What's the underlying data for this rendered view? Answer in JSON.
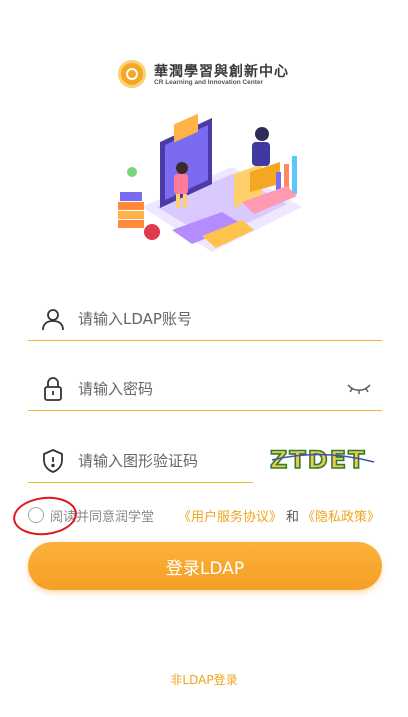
{
  "brand": {
    "title": "華潤學習與創新中心",
    "subtitle": "CR Learning and Innovation Center"
  },
  "form": {
    "username_placeholder": "请输入LDAP账号",
    "password_placeholder": "请输入密码",
    "captcha_placeholder": "请输入图形验证码",
    "captcha_text": "ZTDET"
  },
  "agreement": {
    "lead": "阅读并同意润学堂",
    "terms_link": "《用户服务协议》",
    "and": "和",
    "privacy_link": "《隐私政策》"
  },
  "buttons": {
    "login_label": "登录LDAP",
    "alt_login_label": "非LDAP登录"
  },
  "colors": {
    "accent": "#f5a623",
    "underline": "#f0b72f",
    "annotation": "#e0161b"
  },
  "icons": {
    "username": "user-icon",
    "password": "lock-icon",
    "captcha": "shield-icon",
    "toggle": "eye-closed-icon"
  }
}
